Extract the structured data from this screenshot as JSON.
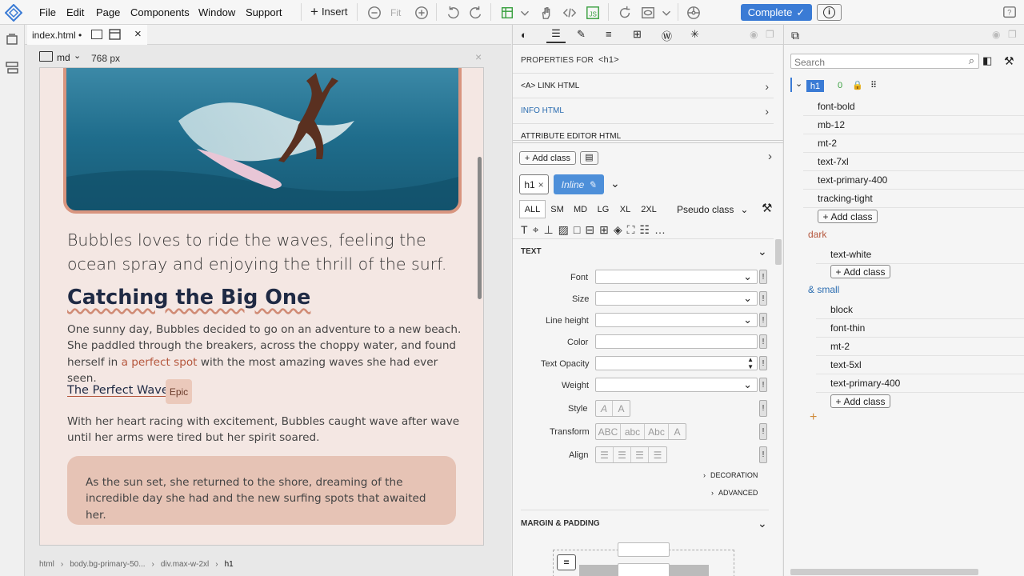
{
  "menu": {
    "items": [
      "File",
      "Edit",
      "Page",
      "Components",
      "Window",
      "Support"
    ],
    "insert_label": "Insert",
    "fit_label": "Fit",
    "complete_label": "Complete"
  },
  "tab": {
    "filename": "index.html •",
    "breakpoint": "md",
    "width": "768 px"
  },
  "canvas": {
    "lead": "Bubbles loves to ride the waves, feeling the ocean spray and enjoying the thrill of the surf.",
    "heading": "Catching the Big One",
    "para1_before": "One sunny day, Bubbles decided to go on an adventure to a new beach. She paddled through the breakers, across the choppy water, and found herself in ",
    "para1_link": "a perfect spot",
    "para1_after": " with the most amazing waves she had ever seen.",
    "subheading": "The Perfect Wave",
    "badge": "Epic",
    "para2": "With her heart racing with excitement, Bubbles caught wave after wave until her arms were tired but her spirit soared.",
    "callout": "As the sun set, she returned to the shore, dreaming of the incredible day she had and the new surfing spots that awaited her."
  },
  "breadcrumb": [
    "html",
    "body.bg-primary-50...",
    "div.max-w-2xl",
    "h1"
  ],
  "props": {
    "header": "PROPERTIES FOR",
    "header_tag": "<h1>",
    "sections": [
      "<A> LINK HTML",
      "INFO HTML",
      "ATTRIBUTE EDITOR HTML"
    ],
    "add_class": "Add class",
    "tag_chip": "h1",
    "inline_chip": "Inline",
    "breakpoints": [
      "ALL",
      "SM",
      "MD",
      "LG",
      "XL",
      "2XL"
    ],
    "pseudo_class": "Pseudo class",
    "text_section": "TEXT",
    "fields": [
      "Font",
      "Size",
      "Line height",
      "Color",
      "Text Opacity",
      "Weight",
      "Style",
      "Transform",
      "Align"
    ],
    "style_opts": [
      "A",
      "A"
    ],
    "transform_opts": [
      "ABC",
      "abc",
      "Abc",
      "A"
    ],
    "decoration": "DECORATION",
    "advanced": "ADVANCED",
    "margin_padding": "MARGIN & PADDING"
  },
  "classes": {
    "search_placeholder": "Search",
    "tag": "h1",
    "count": "0",
    "base": [
      "font-bold",
      "mb-12",
      "mt-2",
      "text-7xl",
      "text-primary-400",
      "tracking-tight"
    ],
    "dark_label": "dark",
    "dark": [
      "text-white"
    ],
    "small_label": "& small",
    "small": [
      "block",
      "font-thin",
      "mt-2",
      "text-5xl",
      "text-primary-400"
    ],
    "add_class": "Add class"
  },
  "colors": {
    "accent": "#3a7bd5",
    "link": "#b5573d",
    "heading": "#1f2a44",
    "callout_bg": "#e6c3b5",
    "badge_bg": "#ebc9bb"
  }
}
